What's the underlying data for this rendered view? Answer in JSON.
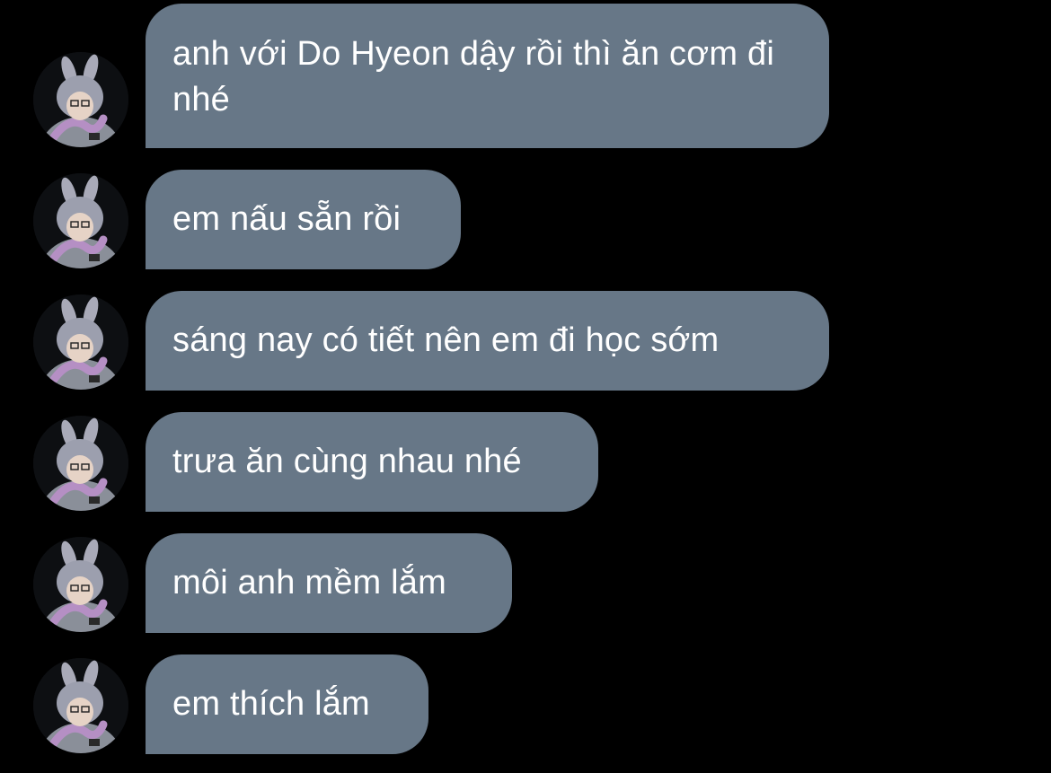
{
  "colors": {
    "background": "#000000",
    "bubble": "#677787",
    "text": "#ffffff"
  },
  "messages": [
    {
      "text": "anh với Do Hyeon dậy rồi thì ăn cơm đi nhé",
      "avatar_icon": "user-avatar-icon"
    },
    {
      "text": "em nấu sẵn rồi",
      "avatar_icon": "user-avatar-icon"
    },
    {
      "text": "sáng nay có tiết nên em đi học sớm",
      "avatar_icon": "user-avatar-icon"
    },
    {
      "text": "trưa ăn cùng nhau nhé",
      "avatar_icon": "user-avatar-icon"
    },
    {
      "text": "môi anh mềm lắm",
      "avatar_icon": "user-avatar-icon"
    },
    {
      "text": "em thích lắm",
      "avatar_icon": "user-avatar-icon"
    }
  ]
}
